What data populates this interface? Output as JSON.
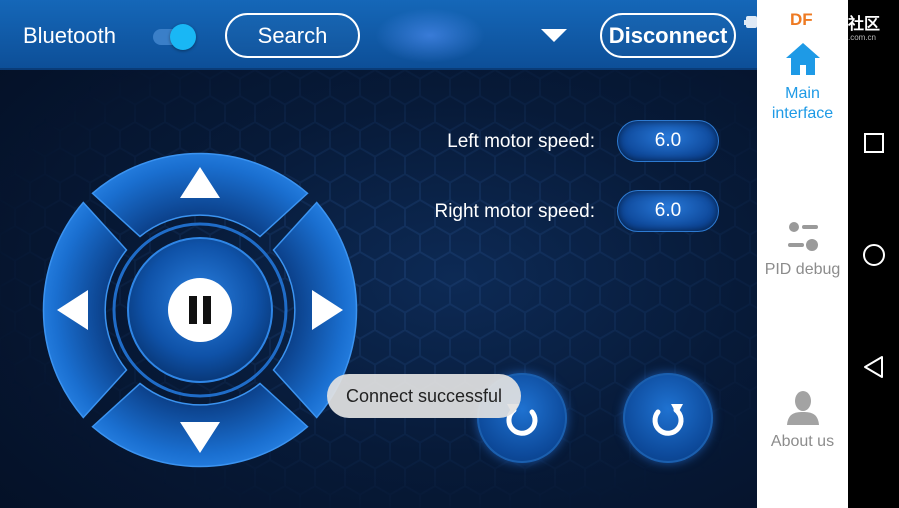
{
  "topbar": {
    "bluetooth_label": "Bluetooth",
    "bluetooth_enabled": true,
    "search_label": "Search",
    "disconnect_label": "Disconnect"
  },
  "motors": {
    "left_label": "Left motor speed:",
    "left_value": "6.0",
    "right_label": "Right motor speed:",
    "right_value": "6.0"
  },
  "toast": {
    "message": "Connect successful"
  },
  "sidebar": {
    "logo": "DF",
    "items": [
      {
        "label": "Main interface",
        "icon": "home-icon",
        "active": true
      },
      {
        "label": "PID debug",
        "icon": "sliders-icon",
        "active": false
      },
      {
        "label": "About us",
        "icon": "user-icon",
        "active": false
      }
    ]
  },
  "system_bar": {
    "brand": "社区",
    "brand_sub": ".com.cn",
    "buttons": [
      "recents-icon",
      "home-circle-icon",
      "back-icon"
    ]
  },
  "colors": {
    "accent": "#1e9ae6",
    "topbar": "#1567b8",
    "background": "#071a38",
    "logo": "#ee7a22"
  }
}
